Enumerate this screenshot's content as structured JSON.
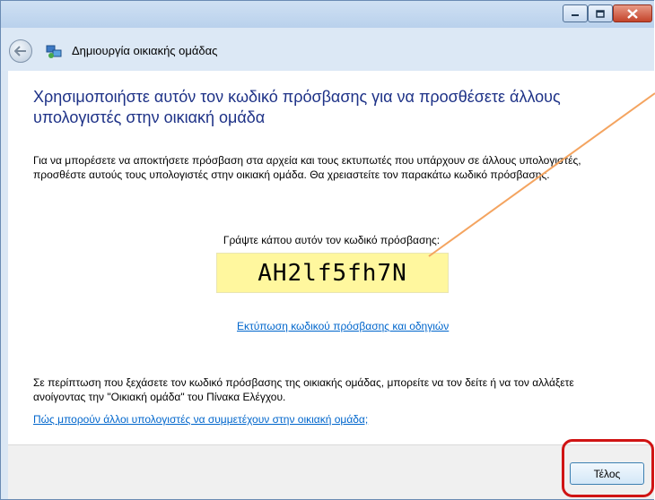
{
  "window": {
    "title": "Δημιουργία οικιακής ομάδας",
    "controls": {
      "minimize": "minimize",
      "maximize": "maximize",
      "close": "close"
    }
  },
  "content": {
    "heading": "Χρησιμοποιήστε αυτόν τον κωδικό πρόσβασης για να προσθέσετε άλλους υπολογιστές στην οικιακή ομάδα",
    "description": "Για να μπορέσετε να αποκτήσετε πρόσβαση στα αρχεία και τους εκτυπωτές που υπάρχουν σε άλλους υπολογιστές, προσθέστε αυτούς τους υπολογιστές στην οικιακή ομάδα. Θα χρειαστείτε τον παρακάτω κωδικό πρόσβασης.",
    "password_instruction": "Γράψτε κάπου αυτόν τον κωδικό πρόσβασης:",
    "password": "AH2lf5fh7N",
    "print_link": "Εκτύπωση κωδικού πρόσβασης και οδηγιών",
    "forgot_note": "Σε περίπτωση που ξεχάσετε τον κωδικό πρόσβασης της οικιακής ομάδας, μπορείτε να τον δείτε ή να τον αλλάξετε ανοίγοντας την \"Οικιακή ομάδα\" του Πίνακα Ελέγχου.",
    "help_link": "Πώς μπορούν άλλοι υπολογιστές να συμμετέχουν στην οικιακή ομάδα;"
  },
  "footer": {
    "finish_button": "Τέλος"
  },
  "colors": {
    "heading": "#1e3287",
    "link": "#0066cc",
    "password_bg": "#fff79e",
    "annotation_box": "#d01414",
    "annotation_line": "#f4a460"
  }
}
